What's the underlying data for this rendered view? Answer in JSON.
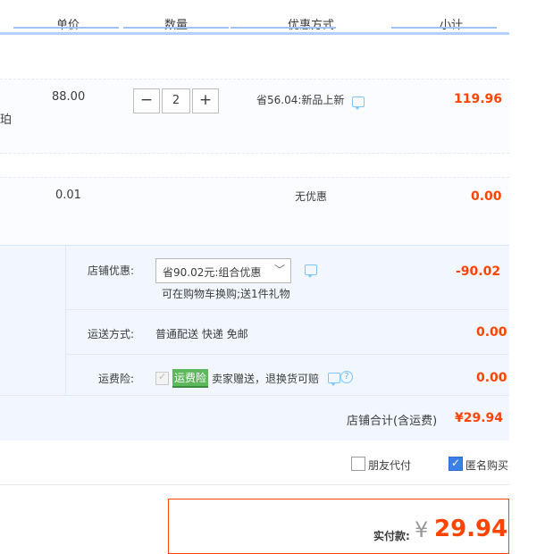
{
  "header": {
    "col_price": "单价",
    "col_qty": "数量",
    "col_discount": "优惠方式",
    "col_subtotal": "小计"
  },
  "items": [
    {
      "label_fragment": "珀",
      "price": "88.00",
      "quantity": "2",
      "discount": "省56.04:新品上新",
      "subtotal": "119.96"
    },
    {
      "price": "0.01",
      "discount": "无优惠",
      "subtotal": "0.00"
    }
  ],
  "shop": {
    "promo_label": "店铺优惠:",
    "promo_selected": "省90.02元:组合优惠",
    "promo_note": "可在购物车换购;送1件礼物",
    "promo_amount": "-90.02",
    "shipping_label": "运送方式:",
    "shipping_value": "普通配送 快递 免邮",
    "shipping_amount": "0.00",
    "insurance_label": "运费险:",
    "insurance_badge": "运费险",
    "insurance_text": "卖家赠送，退换货可赔",
    "insurance_amount": "0.00",
    "total_label": "店铺合计(含运费)",
    "total_amount": "¥29.94"
  },
  "options": {
    "friend_pay": "朋友代付",
    "anonymous": "匿名购买"
  },
  "checkout": {
    "label": "实付款:",
    "currency": "¥",
    "amount": "29.94"
  },
  "colors": {
    "price_red": "#ff4400",
    "accent_blue": "#3c7fe6",
    "header_line": "#b2d1ff",
    "shop_bg": "#f2f7ff",
    "badge_green": "#5cb85c"
  },
  "icons": [
    "minus-icon",
    "plus-icon",
    "chat-icon",
    "chevron-down-icon",
    "help-icon",
    "checkmark-icon"
  ]
}
